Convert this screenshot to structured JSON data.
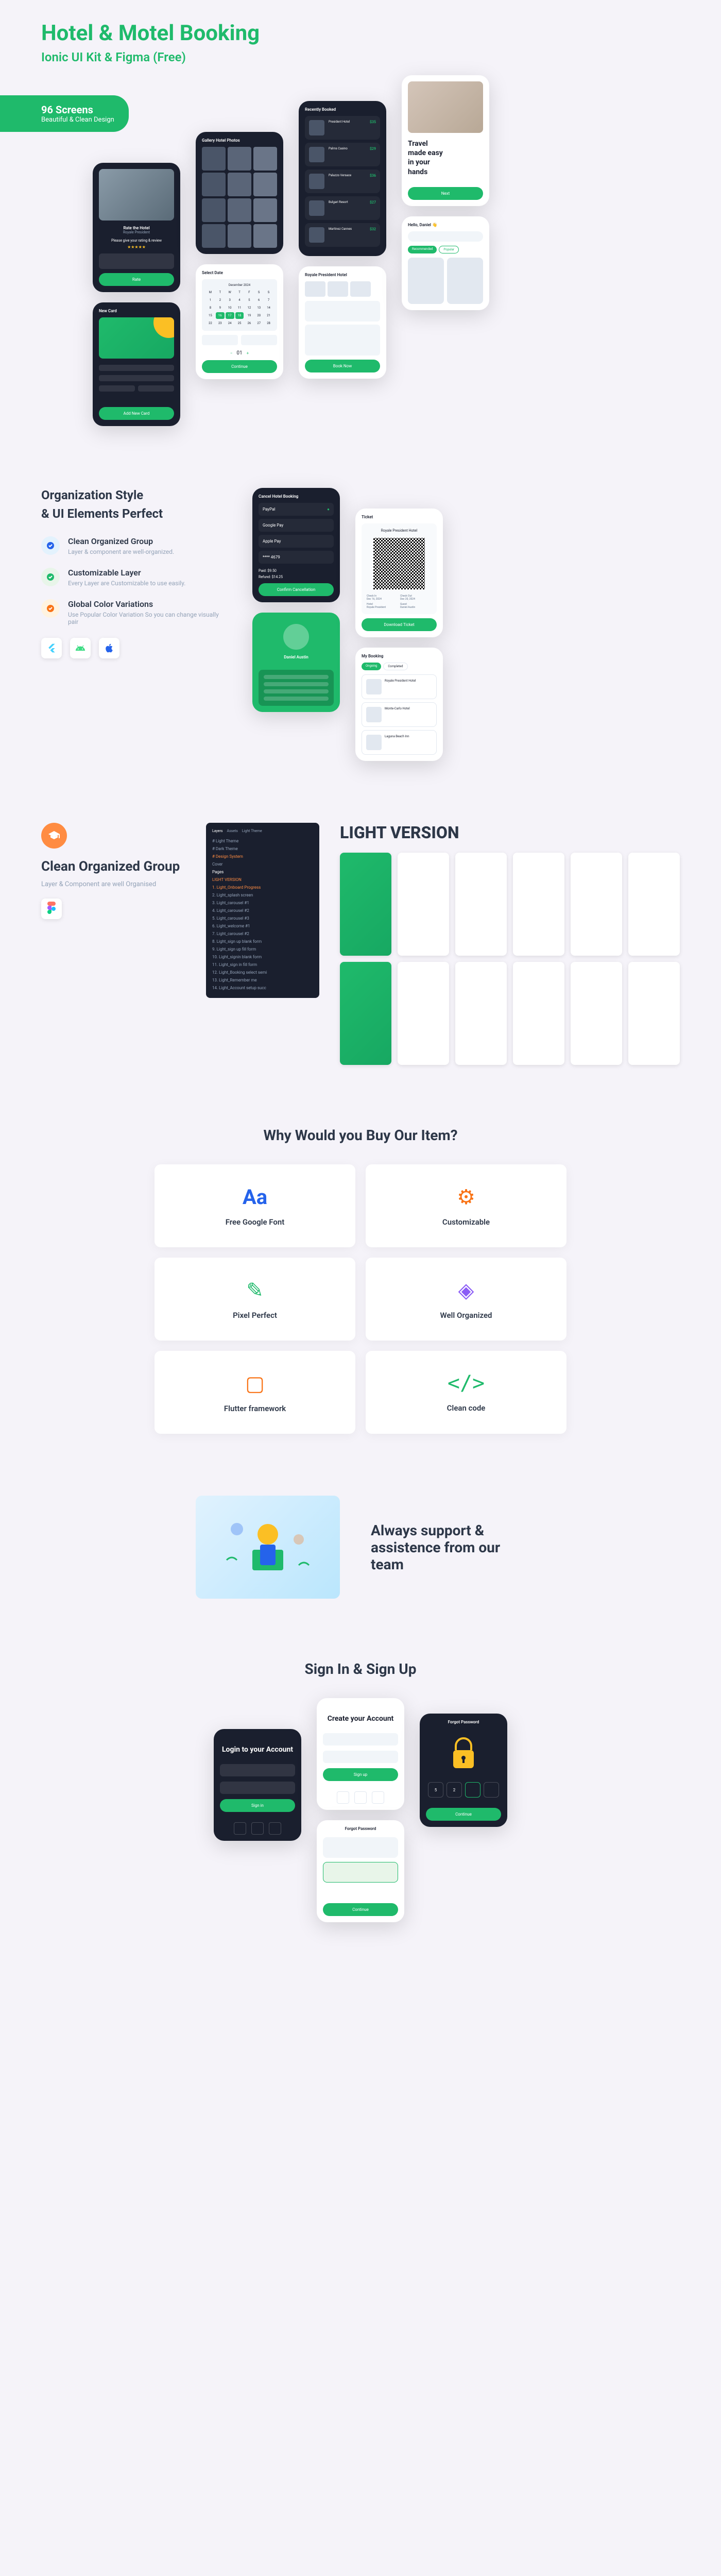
{
  "header": {
    "title": "Hotel & Motel Booking",
    "subtitle": "Ionic UI Kit & Figma (Free)"
  },
  "badge": {
    "title": "96 Screens",
    "subtitle": "Beautiful & Clean Design"
  },
  "organization": {
    "title1": "Organization Style",
    "title2": "& UI Elements Perfect",
    "features": [
      {
        "title": "Clean Organized Group",
        "desc": "Layer & component are well-organized."
      },
      {
        "title": "Customizable Layer",
        "desc": "Every Layer are Customizable to use easily."
      },
      {
        "title": "Global Color Variations",
        "desc": "Use Popular Color Variation So you can change visually pair"
      }
    ]
  },
  "clean_section": {
    "title": "Clean Organized Group",
    "desc": "Layer & Component are well Organised"
  },
  "light_version": {
    "title": "LIGHT VERSION"
  },
  "why_section": {
    "title": "Why Would you Buy Our Item?",
    "items": [
      {
        "icon": "Aa",
        "label": "Free Google Font",
        "color": "#2563eb"
      },
      {
        "icon": "⚙",
        "label": "Customizable",
        "color": "#f97316"
      },
      {
        "icon": "✎",
        "label": "Pixel Perfect",
        "color": "#1fba6b"
      },
      {
        "icon": "◈",
        "label": "Well Organized",
        "color": "#8b5cf6"
      },
      {
        "icon": "▢",
        "label": "Flutter framework",
        "color": "#f97316"
      },
      {
        "icon": "</>",
        "label": "Clean code",
        "color": "#1fba6b"
      }
    ]
  },
  "support": {
    "text": "Always support & assistence from our team"
  },
  "signin": {
    "title": "Sign In & Sign Up"
  },
  "phones": {
    "rate": {
      "title": "Rate the Hotel",
      "subtitle": "Royale President",
      "prompt": "Please give your rating & review",
      "btn": "Rate"
    },
    "gallery": {
      "title": "Gallery Hotel Photos"
    },
    "recently": {
      "title": "Recently Booked",
      "items": [
        {
          "name": "President Hotel",
          "price": "$35"
        },
        {
          "name": "Palms Casino",
          "price": "$29"
        },
        {
          "name": "Palazzo Versace",
          "price": "$36"
        },
        {
          "name": "Bulgari Resort",
          "price": "$27"
        },
        {
          "name": "Martinez Cannes",
          "price": "$32"
        }
      ]
    },
    "travel": {
      "line1": "Travel",
      "line2": "made easy",
      "line3": "in your",
      "line4": "hands",
      "btn": "Next"
    },
    "royale": {
      "title": "Royale President Hotel",
      "btn": "Book Now"
    },
    "hello": {
      "greeting": "Hello, Daniel 👋"
    },
    "newcard": {
      "title": "New Card",
      "btn": "Add New Card"
    },
    "selectdate": {
      "title": "Select Date",
      "btn": "Continue"
    },
    "cancel": {
      "title": "Cancel Hotel Booking",
      "options": [
        "PayPal",
        "Google Pay",
        "Apple Pay",
        "**** 4679"
      ],
      "paid": "Paid: $9.50",
      "refund": "Refund: $14.25",
      "btn": "Confirm Cancellation"
    },
    "ticket": {
      "title": "Ticket",
      "hotel": "Royale President Hotel",
      "btn": "Download Ticket"
    },
    "profile": {
      "name": "Daniel Austin"
    },
    "booking": {
      "title": "My Booking",
      "items": [
        {
          "name": "Royale President Hotel"
        },
        {
          "name": "Monte-Carlo Hotel"
        },
        {
          "name": "Laguna Beach Inn"
        }
      ]
    },
    "login": {
      "title": "Login to your Account",
      "btn": "Sign in"
    },
    "create": {
      "title": "Create your Account",
      "btn": "Sign up"
    },
    "forgot_light": {
      "title": "Forgot Password"
    },
    "forgot_dark": {
      "title": "Forgot Password",
      "btn": "Continue"
    }
  },
  "layers": {
    "header": "Layers",
    "tabs": [
      "Assets",
      "Light Theme"
    ],
    "items": [
      "# Light Theme",
      "# Dark Theme",
      "# Design System",
      "Cover",
      "Pages",
      "LIGHT VERSION",
      "1. Light_Onboard Progress",
      "2. Light_splash screen",
      "3. Light_carousel #1",
      "4. Light_carousel #2",
      "5. Light_carousel #3",
      "6. Light_welcome #1",
      "7. Light_carousel #2",
      "8. Light_sign up blank form",
      "9. Light_sign up fill form",
      "10. Light_signin blank form",
      "11. Light_sign in fill form",
      "12. Light_Booking select semi",
      "13. Light_Remember me",
      "14. Light_Account setup succ"
    ]
  }
}
